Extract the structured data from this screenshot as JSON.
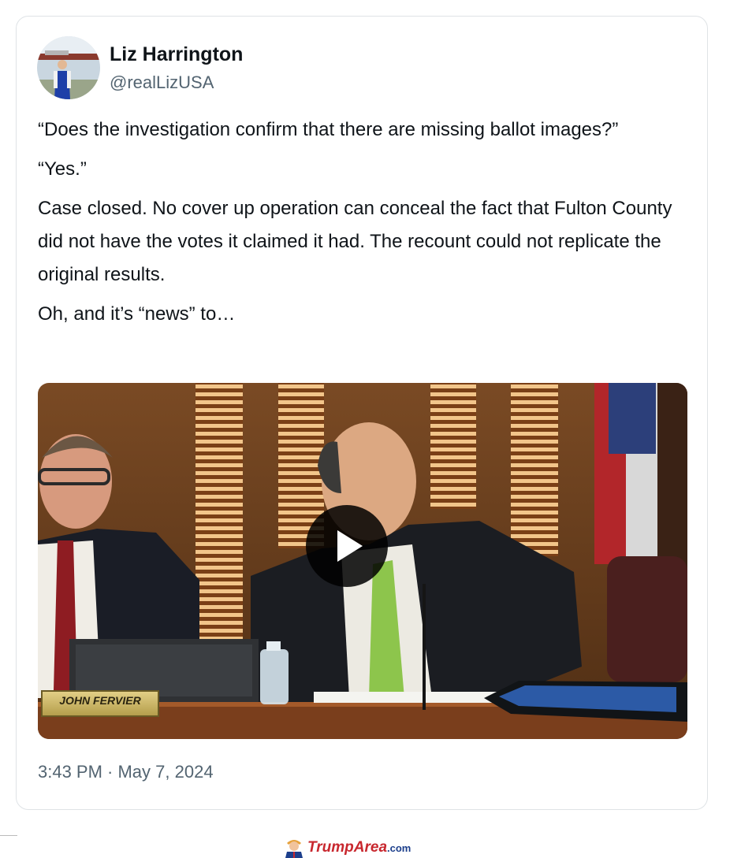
{
  "tweet": {
    "author_name": "Liz Harrington",
    "author_handle": "@realLizUSA",
    "paragraphs": [
      "“Does the investigation confirm that there are missing ballot images?”",
      "“Yes.”",
      "Case closed. No cover up operation can conceal the fact that Fulton County did not have the votes it claimed it had. The recount could not replicate the original results.",
      "Oh, and it’s “news” to…"
    ],
    "timestamp": "3:43 PM · May 7, 2024"
  },
  "video": {
    "nameplate_text": "JOHN FERVIER",
    "play_icon": "play-icon"
  },
  "footer": {
    "site_name": "TrumpArea",
    "site_tld": ".com"
  },
  "colors": {
    "text_primary": "#0f1419",
    "text_secondary": "#536471",
    "card_border": "#dfe3e6",
    "logo_red": "#c8272e",
    "logo_blue": "#1c3f8c"
  }
}
